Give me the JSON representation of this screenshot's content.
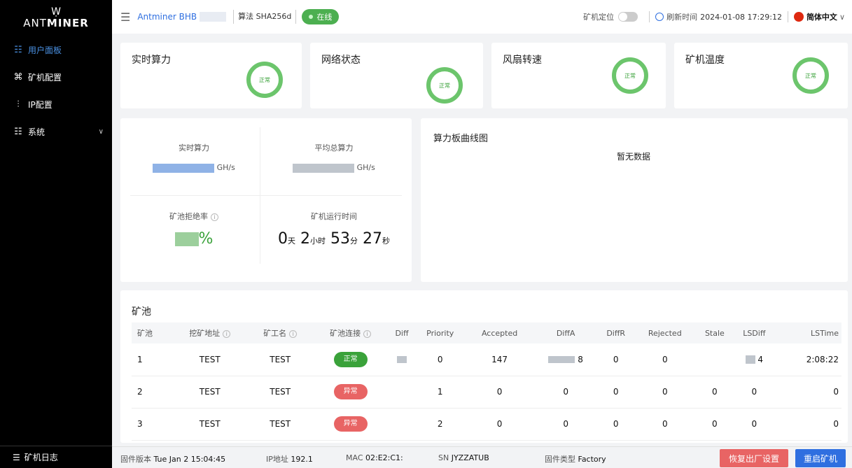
{
  "brand": {
    "name_light": "ANT",
    "name_bold": "MINER",
    "mark": "Ẉ"
  },
  "sidebar": {
    "items": [
      {
        "label": "用户面板",
        "icon": "dashboard-icon",
        "glyph": "☷"
      },
      {
        "label": "矿机配置",
        "icon": "config-icon",
        "glyph": "⌘"
      },
      {
        "label": "IP配置",
        "icon": "sliders-icon",
        "glyph": "⫶"
      },
      {
        "label": "系统",
        "icon": "system-icon",
        "glyph": "☷"
      }
    ],
    "footer_label": "矿机日志"
  },
  "header": {
    "device": "Antminer BHB",
    "algo": "算法 SHA256d",
    "status": "在线",
    "locate_label": "矿机定位",
    "refresh_label": "刷新时间",
    "refresh_time": "2024-01-08 17:29:12",
    "language": "简体中文"
  },
  "status_cards": [
    {
      "title": "实时算力",
      "state": "正常"
    },
    {
      "title": "网络状态",
      "state": "正常"
    },
    {
      "title": "风扇转速",
      "state": "正常"
    },
    {
      "title": "矿机温度",
      "state": "正常"
    }
  ],
  "hashrate": {
    "realtime_label": "实时算力",
    "realtime_unit": "GH/s",
    "average_label": "平均总算力",
    "average_unit": "GH/s",
    "reject_label": "矿池拒绝率",
    "reject_value": "%",
    "runtime_label": "矿机运行时间",
    "runtime": {
      "days": "0",
      "days_unit": "天",
      "hours": "2",
      "hours_unit": "小时",
      "mins": "53",
      "mins_unit": "分",
      "secs": "27",
      "secs_unit": "秒"
    }
  },
  "curve": {
    "title": "算力板曲线图",
    "empty": "暂无数据"
  },
  "pool": {
    "title": "矿池",
    "columns": [
      "矿池",
      "挖矿地址",
      "矿工名",
      "矿池连接",
      "Diff",
      "Priority",
      "Accepted",
      "DiffA",
      "DiffR",
      "Rejected",
      "Stale",
      "LSDiff",
      "LSTime"
    ],
    "rows": [
      {
        "idx": "1",
        "addr": "TEST",
        "worker": "TEST",
        "conn": "正常",
        "ok": true,
        "priority": "0",
        "accepted": "147",
        "diffa": "8",
        "diffr": "0",
        "rejected": "0",
        "stale": "",
        "lsdiff": "4",
        "lstime": "2:08:22"
      },
      {
        "idx": "2",
        "addr": "TEST",
        "worker": "TEST",
        "conn": "异常",
        "ok": false,
        "priority": "1",
        "accepted": "0",
        "diffa": "0",
        "diffr": "0",
        "rejected": "0",
        "stale": "0",
        "lsdiff": "0",
        "lstime": "0"
      },
      {
        "idx": "3",
        "addr": "TEST",
        "worker": "TEST",
        "conn": "异常",
        "ok": false,
        "priority": "2",
        "accepted": "0",
        "diffa": "0",
        "diffr": "0",
        "rejected": "0",
        "stale": "0",
        "lsdiff": "0",
        "lstime": "0"
      }
    ]
  },
  "footer": {
    "fw_label": "固件版本",
    "fw_value": "Tue Jan 2 15:04:45",
    "ip_label": "IP地址",
    "ip_value": "192.1",
    "mac_label": "MAC",
    "mac_value": "02:E2:C1:",
    "sn_label": "SN",
    "sn_value": "JYZZATUB",
    "type_label": "固件类型",
    "type_value": "Factory",
    "reset_label": "恢复出厂设置",
    "reboot_label": "重启矿机"
  },
  "colors": {
    "accent": "#2f6fe0",
    "ok": "#3aa23a",
    "bad": "#e86464",
    "sidebar": "#000000"
  }
}
